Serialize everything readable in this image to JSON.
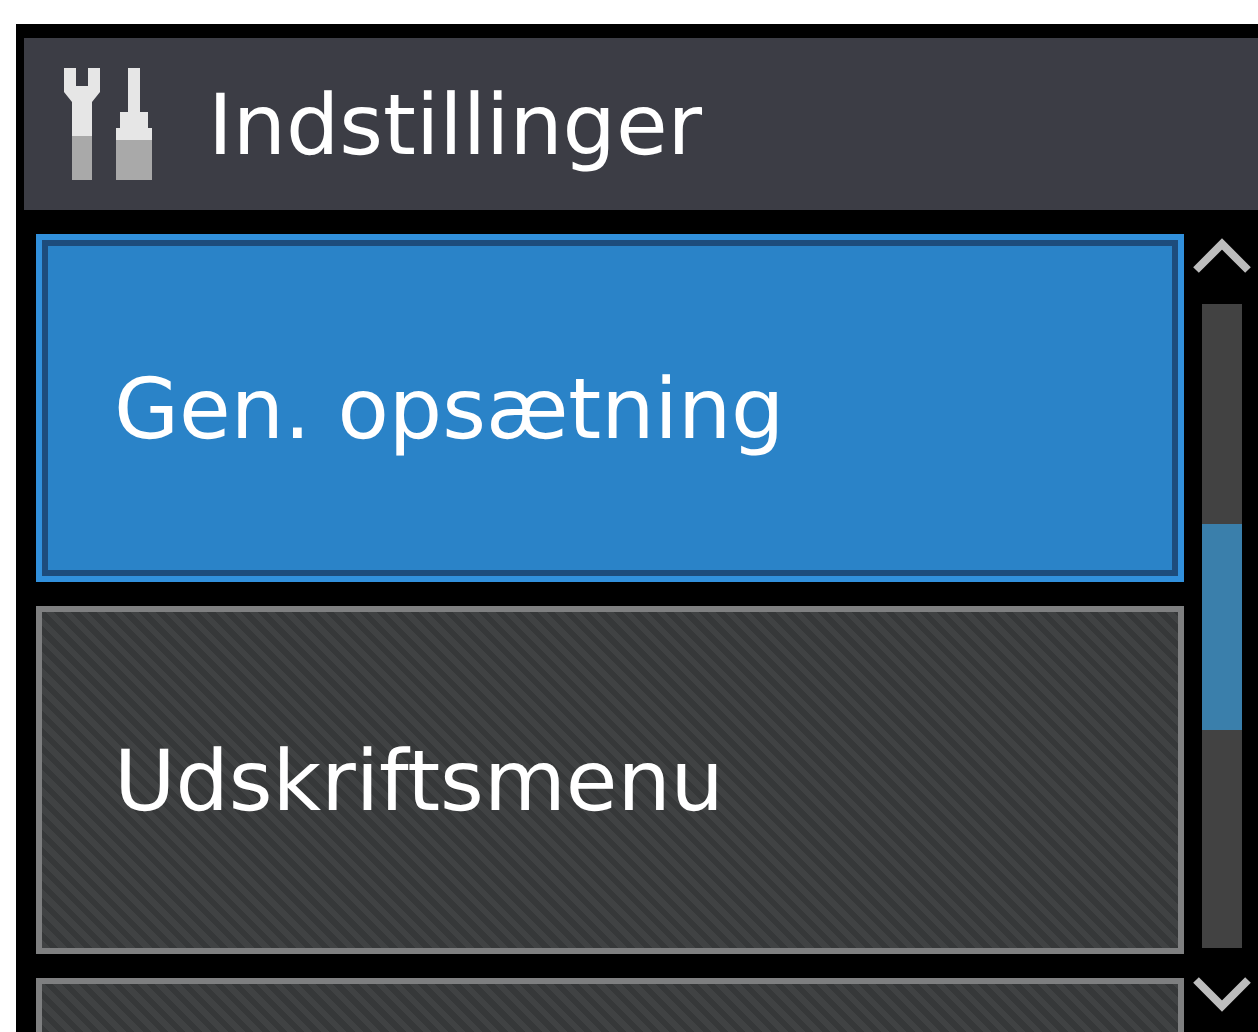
{
  "header": {
    "title": "Indstillinger"
  },
  "menu_items": [
    {
      "label": "Gen. opsætning",
      "selected": true
    },
    {
      "label": "Udskriftsmenu",
      "selected": false
    }
  ],
  "more_below": true
}
